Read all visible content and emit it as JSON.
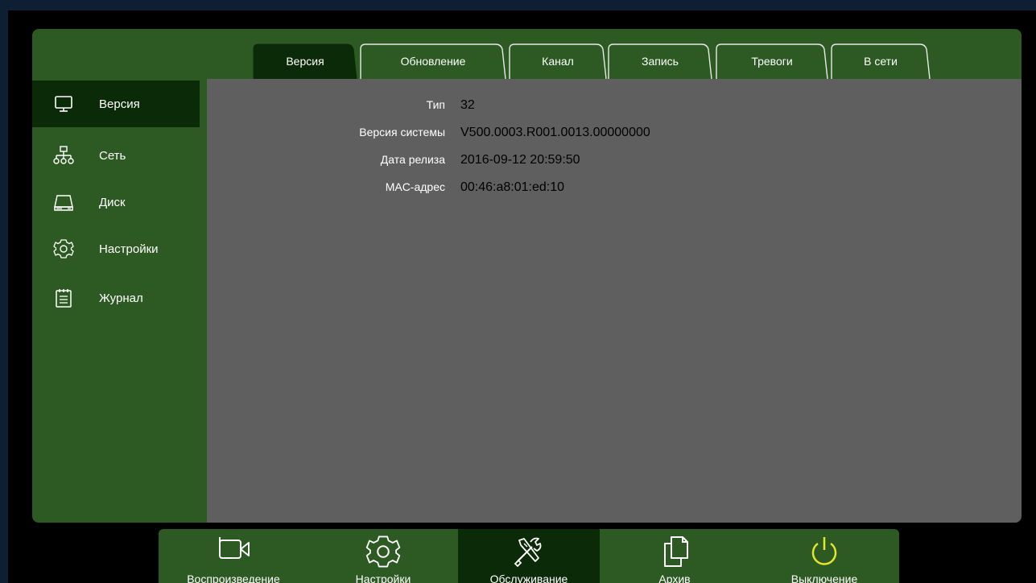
{
  "sidebar": {
    "items": [
      {
        "label": "Версия",
        "icon": "monitor-icon",
        "active": true
      },
      {
        "label": "Сеть",
        "icon": "network-icon",
        "active": false
      },
      {
        "label": "Диск",
        "icon": "disk-icon",
        "active": false
      },
      {
        "label": "Настройки",
        "icon": "gear-icon",
        "active": false
      },
      {
        "label": "Журнал",
        "icon": "journal-icon",
        "active": false
      }
    ]
  },
  "tabs": [
    {
      "label": "Версия",
      "active": true
    },
    {
      "label": "Обновление",
      "active": false
    },
    {
      "label": "Канал",
      "active": false
    },
    {
      "label": "Запись",
      "active": false
    },
    {
      "label": "Тревоги",
      "active": false
    },
    {
      "label": "В сети",
      "active": false
    }
  ],
  "info": {
    "type_label": "Тип",
    "type_value": "32",
    "version_label": "Версия системы",
    "version_value": "V500.0003.R001.0013.00000000",
    "release_label": "Дата релиза",
    "release_value": "2016-09-12 20:59:50",
    "mac_label": "MAC-адрес",
    "mac_value": "00:46:a8:01:ed:10"
  },
  "bottom": {
    "items": [
      {
        "label": "Воспроизведение",
        "icon": "camera-icon",
        "active": false
      },
      {
        "label": "Настройки",
        "icon": "gear-icon",
        "active": false
      },
      {
        "label": "Обслуживание",
        "icon": "tools-icon",
        "active": true
      },
      {
        "label": "Архив",
        "icon": "archive-icon",
        "active": false
      },
      {
        "label": "Выключение",
        "icon": "power-icon",
        "active": false
      }
    ]
  },
  "colors": {
    "panel_green": "#2c5a22",
    "active_dark_green": "#0b2b08",
    "content_gray": "#5f5f5f",
    "power_yellow": "#e5e52a"
  }
}
